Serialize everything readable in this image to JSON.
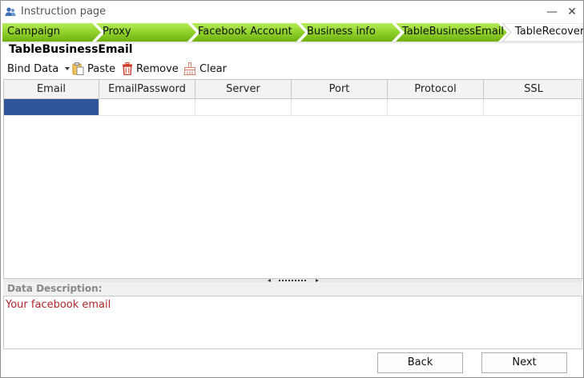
{
  "window": {
    "title": "Instruction page",
    "minimize_label": "—",
    "close_label": "✕"
  },
  "steps": [
    {
      "label": "Campaign",
      "active": true
    },
    {
      "label": "Proxy",
      "active": true
    },
    {
      "label": "Facebook Account",
      "active": true
    },
    {
      "label": "Business info",
      "active": true
    },
    {
      "label": "TableBusinessEmail",
      "active": true
    },
    {
      "label": "TableRecoverB",
      "active": false
    }
  ],
  "colors": {
    "step_green": "#8fd12b",
    "step_green_dark": "#6fb010",
    "selected_cell": "#2e5597",
    "description_text": "#b0262a"
  },
  "section": {
    "title": "TableBusinessEmail"
  },
  "toolbar": {
    "bind_data_label": "Bind Data",
    "paste_label": "Paste",
    "remove_label": "Remove",
    "clear_label": "Clear"
  },
  "table": {
    "columns": [
      "Email",
      "EmailPassword",
      "Server",
      "Port",
      "Protocol",
      "SSL"
    ],
    "rows": [
      [
        "",
        "",
        "",
        "",
        "",
        ""
      ]
    ]
  },
  "description": {
    "label": "Data Description:",
    "text": "Your facebook email"
  },
  "buttons": {
    "back_label": "Back",
    "next_label": "Next"
  }
}
